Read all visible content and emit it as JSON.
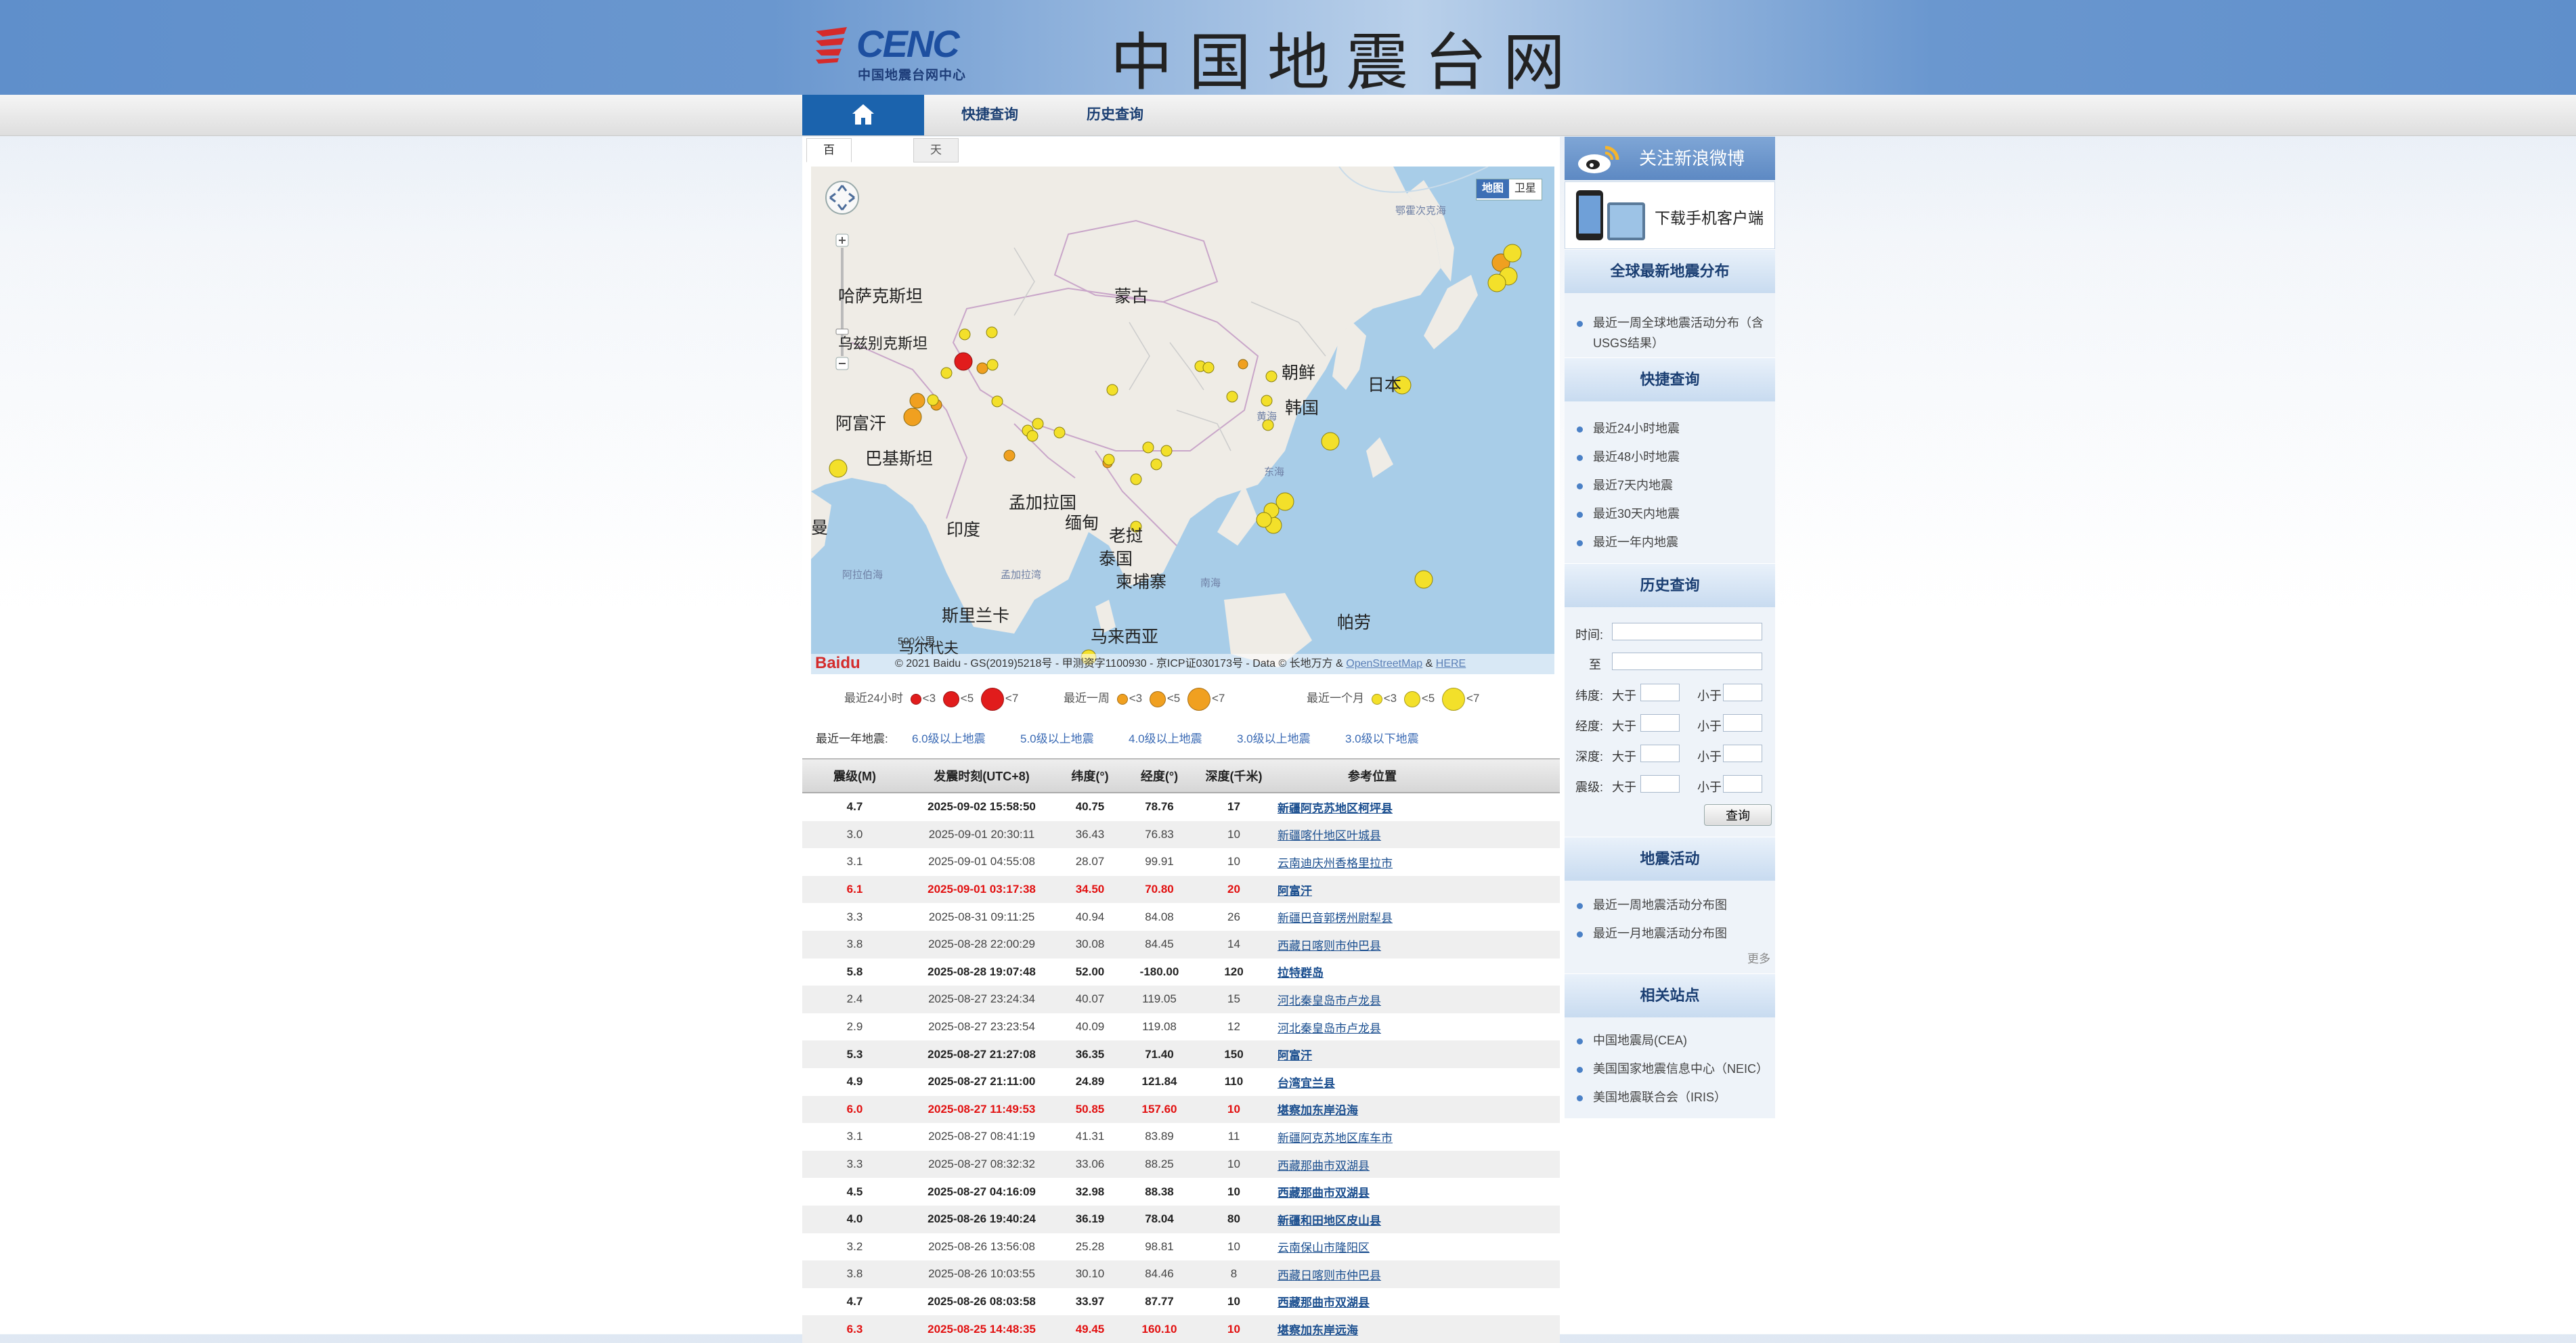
{
  "header": {
    "logo_text": "CENC",
    "logo_subtitle": "中国地震台网中心",
    "site_title": "中国地震台网"
  },
  "nav": {
    "items": [
      "快捷查询",
      "历史查询"
    ]
  },
  "map": {
    "tabs": [
      "百度地图",
      "天地图"
    ],
    "type_buttons": [
      "地图",
      "卫星"
    ],
    "labels": [
      "蒙古",
      "哈萨克斯坦",
      "乌兹别克斯坦",
      "朝鲜",
      "韩国",
      "日本",
      "阿富汗",
      "巴基斯坦",
      "印度",
      "孟加拉国",
      "缅甸",
      "老挝",
      "泰国",
      "柬埔寨",
      "斯里兰卡",
      "马来西亚",
      "马尔代夫",
      "帕劳",
      "曼",
      "鄂霍次克海",
      "黄海",
      "东海",
      "南海",
      "阿拉伯海",
      "孟加拉湾",
      "500公里"
    ],
    "copyright": "© 2021 Baidu - GS(2019)5218号 - 甲测资字1100930 - 京ICP证030173号 - Data © 长地万方 & ",
    "copyright_links": [
      "OpenStreetMap",
      "HERE"
    ],
    "baidu_logo": "Baidu"
  },
  "legend": {
    "groups": [
      {
        "label": "最近24小时",
        "items": [
          "<3",
          "<5",
          "<7"
        ],
        "color": "#e11c1c"
      },
      {
        "label": "最近一周",
        "items": [
          "<3",
          "<5",
          "<7"
        ],
        "color": "#f0a020"
      },
      {
        "label": "最近一个月",
        "items": [
          "<3",
          "<5",
          "<7"
        ],
        "color": "#f3e02a"
      }
    ]
  },
  "quicklinks": {
    "label": "最近一年地震:",
    "links": [
      "6.0级以上地震",
      "5.0级以上地震",
      "4.0级以上地震",
      "3.0级以上地震",
      "3.0级以下地震"
    ]
  },
  "table": {
    "headers": [
      "震级(M)",
      "发震时刻(UTC+8)",
      "纬度(°)",
      "经度(°)",
      "深度(千米)",
      "参考位置"
    ],
    "rows": [
      {
        "m": "4.7",
        "t": "2025-09-02 15:58:50",
        "lat": "40.75",
        "lon": "78.76",
        "d": "17",
        "loc": "新疆阿克苏地区柯坪县",
        "style": "b"
      },
      {
        "m": "3.0",
        "t": "2025-09-01 20:30:11",
        "lat": "36.43",
        "lon": "76.83",
        "d": "10",
        "loc": "新疆喀什地区叶城县",
        "style": "n"
      },
      {
        "m": "3.1",
        "t": "2025-09-01 04:55:08",
        "lat": "28.07",
        "lon": "99.91",
        "d": "10",
        "loc": "云南迪庆州香格里拉市",
        "style": "n"
      },
      {
        "m": "6.1",
        "t": "2025-09-01 03:17:38",
        "lat": "34.50",
        "lon": "70.80",
        "d": "20",
        "loc": "阿富汗",
        "style": "r"
      },
      {
        "m": "3.3",
        "t": "2025-08-31 09:11:25",
        "lat": "40.94",
        "lon": "84.08",
        "d": "26",
        "loc": "新疆巴音郭楞州尉犁县",
        "style": "n"
      },
      {
        "m": "3.8",
        "t": "2025-08-28 22:00:29",
        "lat": "30.08",
        "lon": "84.45",
        "d": "14",
        "loc": "西藏日喀则市仲巴县",
        "style": "n"
      },
      {
        "m": "5.8",
        "t": "2025-08-28 19:07:48",
        "lat": "52.00",
        "lon": "-180.00",
        "d": "120",
        "loc": "拉特群岛",
        "style": "b"
      },
      {
        "m": "2.4",
        "t": "2025-08-27 23:24:34",
        "lat": "40.07",
        "lon": "119.05",
        "d": "15",
        "loc": "河北秦皇岛市卢龙县",
        "style": "n"
      },
      {
        "m": "2.9",
        "t": "2025-08-27 23:23:54",
        "lat": "40.09",
        "lon": "119.08",
        "d": "12",
        "loc": "河北秦皇岛市卢龙县",
        "style": "n"
      },
      {
        "m": "5.3",
        "t": "2025-08-27 21:27:08",
        "lat": "36.35",
        "lon": "71.40",
        "d": "150",
        "loc": "阿富汗",
        "style": "b"
      },
      {
        "m": "4.9",
        "t": "2025-08-27 21:11:00",
        "lat": "24.89",
        "lon": "121.84",
        "d": "110",
        "loc": "台湾宜兰县",
        "style": "b"
      },
      {
        "m": "6.0",
        "t": "2025-08-27 11:49:53",
        "lat": "50.85",
        "lon": "157.60",
        "d": "10",
        "loc": "堪察加东岸沿海",
        "style": "r"
      },
      {
        "m": "3.1",
        "t": "2025-08-27 08:41:19",
        "lat": "41.31",
        "lon": "83.89",
        "d": "11",
        "loc": "新疆阿克苏地区库车市",
        "style": "n"
      },
      {
        "m": "3.3",
        "t": "2025-08-27 08:32:32",
        "lat": "33.06",
        "lon": "88.25",
        "d": "10",
        "loc": "西藏那曲市双湖县",
        "style": "n"
      },
      {
        "m": "4.5",
        "t": "2025-08-27 04:16:09",
        "lat": "32.98",
        "lon": "88.38",
        "d": "10",
        "loc": "西藏那曲市双湖县",
        "style": "b"
      },
      {
        "m": "4.0",
        "t": "2025-08-26 19:40:24",
        "lat": "36.19",
        "lon": "78.04",
        "d": "80",
        "loc": "新疆和田地区皮山县",
        "style": "b"
      },
      {
        "m": "3.2",
        "t": "2025-08-26 13:56:08",
        "lat": "25.28",
        "lon": "98.81",
        "d": "10",
        "loc": "云南保山市隆阳区",
        "style": "n"
      },
      {
        "m": "3.8",
        "t": "2025-08-26 10:03:55",
        "lat": "30.10",
        "lon": "84.46",
        "d": "8",
        "loc": "西藏日喀则市仲巴县",
        "style": "n"
      },
      {
        "m": "4.7",
        "t": "2025-08-26 08:03:58",
        "lat": "33.97",
        "lon": "87.77",
        "d": "10",
        "loc": "西藏那曲市双湖县",
        "style": "b"
      },
      {
        "m": "6.3",
        "t": "2025-08-25 14:48:35",
        "lat": "49.45",
        "lon": "160.10",
        "d": "10",
        "loc": "堪察加东岸远海",
        "style": "r"
      }
    ]
  },
  "sidebar": {
    "weibo": "关注新浪微博",
    "app_download": "下载手机客户端",
    "global": {
      "title": "全球最新地震分布",
      "items": [
        "最近一周全球地震活动分布（含USGS结果）"
      ]
    },
    "quick": {
      "title": "快捷查询",
      "items": [
        "最近24小时地震",
        "最近48小时地震",
        "最近7天内地震",
        "最近30天内地震",
        "最近一年内地震"
      ]
    },
    "history": {
      "title": "历史查询",
      "time_label": "时间:",
      "to_label": "至",
      "fields": [
        {
          "label": "纬度:",
          "gt": "大于",
          "lt": "小于"
        },
        {
          "label": "经度:",
          "gt": "大于",
          "lt": "小于"
        },
        {
          "label": "深度:",
          "gt": "大于",
          "lt": "小于"
        },
        {
          "label": "震级:",
          "gt": "大于",
          "lt": "小于"
        }
      ],
      "button": "查询"
    },
    "activity": {
      "title": "地震活动",
      "items": [
        "最近一周地震活动分布图",
        "最近一月地震活动分布图"
      ],
      "more": "更多"
    },
    "related": {
      "title": "相关站点",
      "items": [
        "中国地震局(CEA)",
        "美国国家地震信息中心（NEIC）",
        "美国地震联合会（IRIS）"
      ]
    }
  }
}
